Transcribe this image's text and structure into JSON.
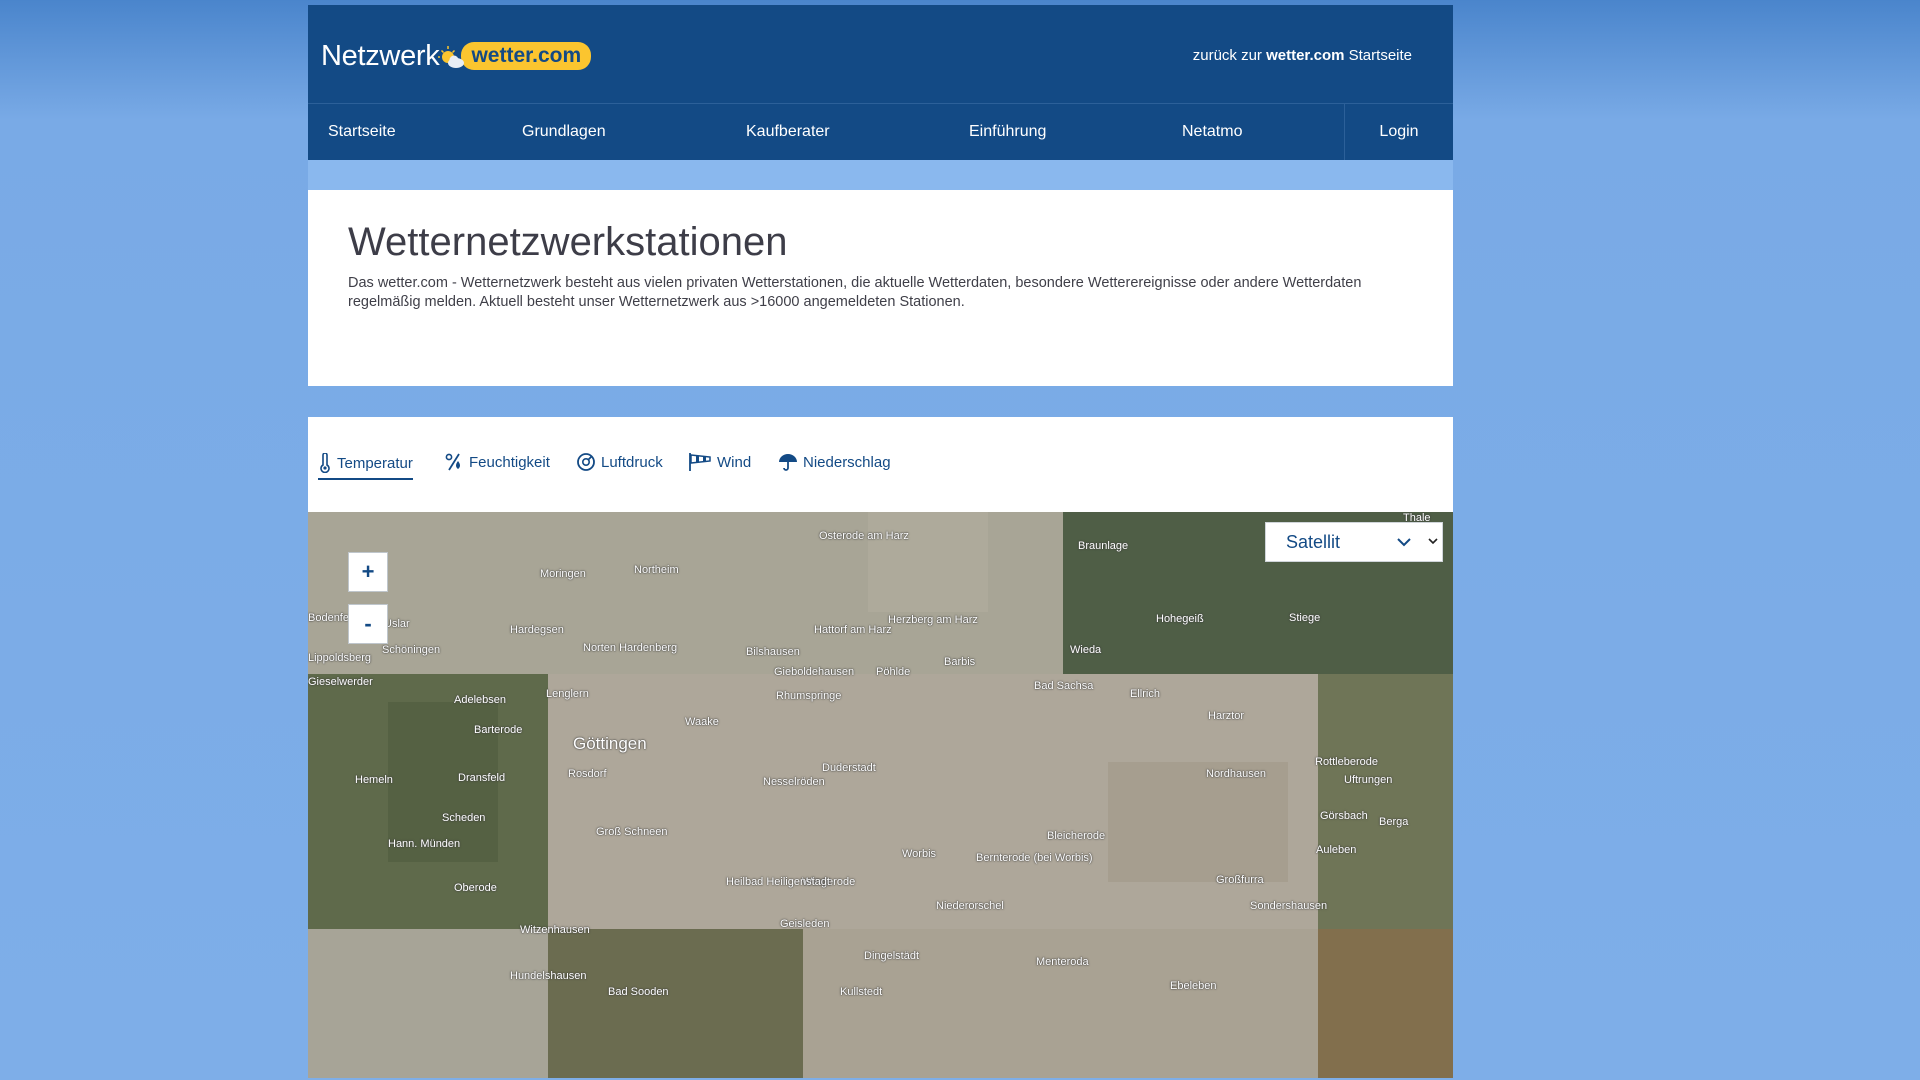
{
  "header": {
    "logo_text": "Netzwerk",
    "logo_brand": "wetter.com",
    "back_prefix": "zurück zur ",
    "back_brand": "wetter.com",
    "back_suffix": " Startseite"
  },
  "nav": {
    "items": [
      "Startseite",
      "Grundlagen",
      "Kaufberater",
      "Einführung",
      "Netatmo"
    ],
    "login": "Login"
  },
  "intro": {
    "title": "Wetternetzwerkstationen",
    "text": "Das wetter.com - Wetternetzwerk besteht aus vielen privaten Wetterstationen, die aktuelle Wetterdaten, besondere Wetterereignisse oder andere Wetterdaten regelmäßig melden. Aktuell besteht unser Wetternetzwerk aus >16000 angemeldeten Stationen."
  },
  "tabs": [
    {
      "label": "Temperatur",
      "icon": "thermometer-icon",
      "active": true
    },
    {
      "label": "Feuchtigkeit",
      "icon": "humidity-icon",
      "active": false
    },
    {
      "label": "Luftdruck",
      "icon": "pressure-gauge-icon",
      "active": false
    },
    {
      "label": "Wind",
      "icon": "windsock-icon",
      "active": false
    },
    {
      "label": "Niederschlag",
      "icon": "umbrella-icon",
      "active": false
    }
  ],
  "map": {
    "zoom_in": "+",
    "zoom_out": "-",
    "layer": "Satellit",
    "places": [
      "Osterode am Harz",
      "Braunlage",
      "Thale",
      "Moringen",
      "Northeim",
      "Herzberg am Harz",
      "Hohegeiß",
      "Stiege",
      "Hardegsen",
      "Hattorf am Harz",
      "Wieda",
      "Norten Hardenberg",
      "Bilshausen",
      "Barbis",
      "Schöningen",
      "Gieboldehausen",
      "Pöhlde",
      "Bad Sachsa",
      "Ellrich",
      "Bodenfelde",
      "Uslar",
      "Lenglern",
      "Rhumspringe",
      "Adelebsen",
      "Waake",
      "Harztor",
      "Barterode",
      "Göttingen",
      "Rottleberode",
      "Duderstadt",
      "Nordhausen",
      "Uftrungen",
      "Hemeln",
      "Dransfeld",
      "Rosdorf",
      "Nesselröden",
      "Görsbach",
      "Berga",
      "Scheden",
      "Groß Schneen",
      "Bleicherode",
      "Auleben",
      "Hann. Münden",
      "Worbis",
      "Bernterode (bei Worbis)",
      "Wingerode",
      "Großfurra",
      "Oberode",
      "Heilbad Heiligenstadt",
      "Niederorschel",
      "Sondershausen",
      "Witzenhausen",
      "Geisleden",
      "Dingelstädt",
      "Menteroda",
      "Hundelshausen",
      "Bad Sooden",
      "Kullstedt",
      "Ebeleben",
      "Lippoldsberg",
      "Gieselwerder"
    ]
  },
  "colors": {
    "brand": "#134a85",
    "logo_pill": "#fbc52f",
    "background": "#7eaee8"
  }
}
